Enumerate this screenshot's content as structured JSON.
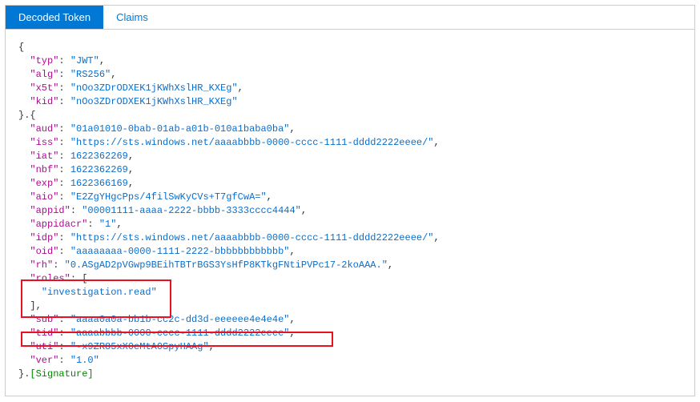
{
  "tabs": {
    "decoded": "Decoded Token",
    "claims": "Claims"
  },
  "token": {
    "header": {
      "typ_key": "\"typ\"",
      "typ_val": "\"JWT\"",
      "alg_key": "\"alg\"",
      "alg_val": "\"RS256\"",
      "x5t_key": "\"x5t\"",
      "x5t_val": "\"nOo3ZDrODXEK1jKWhXslHR_KXEg\"",
      "kid_key": "\"kid\"",
      "kid_val": "\"nOo3ZDrODXEK1jKWhXslHR_KXEg\""
    },
    "payload": {
      "aud_key": "\"aud\"",
      "aud_val": "\"01a01010-0bab-01ab-a01b-010a1baba0ba\"",
      "iss_key": "\"iss\"",
      "iss_val": "\"https://sts.windows.net/aaaabbbb-0000-cccc-1111-dddd2222eeee/\"",
      "iat_key": "\"iat\"",
      "iat_val": "1622362269",
      "nbf_key": "\"nbf\"",
      "nbf_val": "1622362269",
      "exp_key": "\"exp\"",
      "exp_val": "1622366169",
      "aio_key": "\"aio\"",
      "aio_val": "\"E2ZgYHgcPps/4filSwKyCVs+T7gfCwA=\"",
      "appid_key": "\"appid\"",
      "appid_val": "\"00001111-aaaa-2222-bbbb-3333cccc4444\"",
      "appidacr_key": "\"appidacr\"",
      "appidacr_val": "\"1\"",
      "idp_key": "\"idp\"",
      "idp_val": "\"https://sts.windows.net/aaaabbbb-0000-cccc-1111-dddd2222eeee/\"",
      "oid_key": "\"oid\"",
      "oid_val": "\"aaaaaaaa-0000-1111-2222-bbbbbbbbbbbb\"",
      "rh_key": "\"rh\"",
      "rh_val": "\"0.ASgAD2pVGwp9BEihTBTrBGS3YsHfP8KTkgFNtiPVPc17-2koAAA.\"",
      "roles_key": "\"roles\"",
      "roles_val": "\"investigation.read\"",
      "sub_key": "\"sub\"",
      "sub_val": "\"aaaa0a0a-bb1b-cc2c-dd3d-eeeeee4e4e4e\"",
      "tid_key": "\"tid\"",
      "tid_val": "\"aaaabbbb-0000-cccc-1111-dddd2222eeee\"",
      "uti_key": "\"uti\"",
      "uti_val": "\"-x9ZR85xX0eMtA0SpyHAAg\"",
      "ver_key": "\"ver\"",
      "ver_val": "\"1.0\""
    },
    "signature": "[Signature]"
  }
}
